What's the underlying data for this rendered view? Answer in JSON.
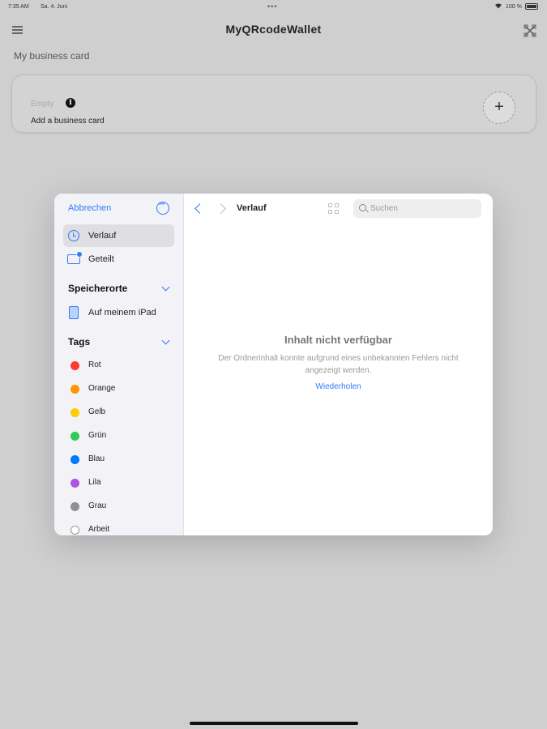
{
  "status_bar": {
    "time": "7:35 AM",
    "date": "Sa. 4. Juni",
    "dots": "•••",
    "battery": "100 %"
  },
  "app": {
    "title": "MyQRcodeWallet",
    "section_label": "My business card"
  },
  "business_card": {
    "empty_label": "Empty",
    "info_glyph": "i",
    "add_label": "Add a business card",
    "plus_glyph": "+"
  },
  "picker": {
    "cancel_label": "Abbrechen",
    "items": [
      {
        "label": "Verlauf"
      },
      {
        "label": "Geteilt"
      }
    ],
    "locations_header": "Speicherorte",
    "locations": [
      {
        "label": "Auf meinem iPad"
      }
    ],
    "tags_header": "Tags",
    "tags": [
      {
        "label": "Rot",
        "color": "#ff3b30"
      },
      {
        "label": "Orange",
        "color": "#ff9500"
      },
      {
        "label": "Gelb",
        "color": "#ffcc00"
      },
      {
        "label": "Grün",
        "color": "#34c759"
      },
      {
        "label": "Blau",
        "color": "#007aff"
      },
      {
        "label": "Lila",
        "color": "#af52de"
      },
      {
        "label": "Grau",
        "color": "#8e8e93"
      },
      {
        "label": "Arbeit",
        "color": ""
      }
    ],
    "location_title": "Verlauf",
    "search_placeholder": "Suchen",
    "empty_title": "Inhalt nicht verfügbar",
    "empty_description": "Der Ordnerinhalt konnte aufgrund eines unbekannten Fehlers nicht angezeigt werden.",
    "retry_label": "Wiederholen"
  }
}
